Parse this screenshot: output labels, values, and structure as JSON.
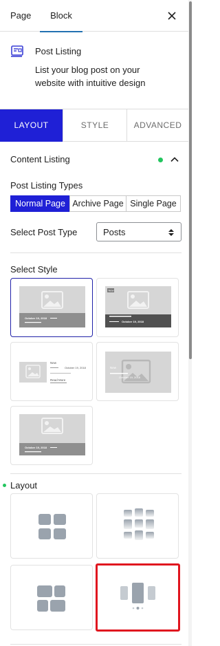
{
  "header": {
    "tabs": [
      {
        "label": "Page"
      },
      {
        "label": "Block"
      }
    ],
    "active_tab": "Block",
    "close_icon": "close-icon"
  },
  "block": {
    "icon": "post-listing-icon",
    "title": "Post Listing",
    "description": "List your blog post on your website with intuitive design"
  },
  "settings_tabs": [
    {
      "label": "LAYOUT"
    },
    {
      "label": "STYLE"
    },
    {
      "label": "ADVANCED"
    }
  ],
  "active_settings_tab": "LAYOUT",
  "content_listing": {
    "title": "Content Listing",
    "status_color": "#22c55e",
    "post_listing_types_label": "Post Listing Types",
    "types": [
      {
        "label": "Normal Page"
      },
      {
        "label": "Archive Page"
      },
      {
        "label": "Single Page"
      }
    ],
    "selected_type": "Normal Page",
    "select_post_type_label": "Select Post Type",
    "post_type_value": "Posts",
    "select_style_label": "Select Style",
    "styles": [
      {
        "id": "style-1",
        "date": "October 19, 2018",
        "selected": true
      },
      {
        "id": "style-2",
        "tag": "New",
        "date": "October 19, 2018"
      },
      {
        "id": "style-3",
        "tag": "New",
        "date": "October 19, 2018",
        "link": "Read More"
      },
      {
        "id": "style-4",
        "tag": "New",
        "date": "October 19, 2018"
      },
      {
        "id": "style-5",
        "date": "October 19, 2018"
      }
    ],
    "layout_label": "Layout",
    "layouts": [
      {
        "id": "grid"
      },
      {
        "id": "masonry"
      },
      {
        "id": "grid-wide"
      },
      {
        "id": "slider",
        "highlighted": true
      }
    ]
  },
  "colors": {
    "accent": "#1f20d6",
    "highlight": "#e0141e",
    "status": "#22c55e"
  }
}
